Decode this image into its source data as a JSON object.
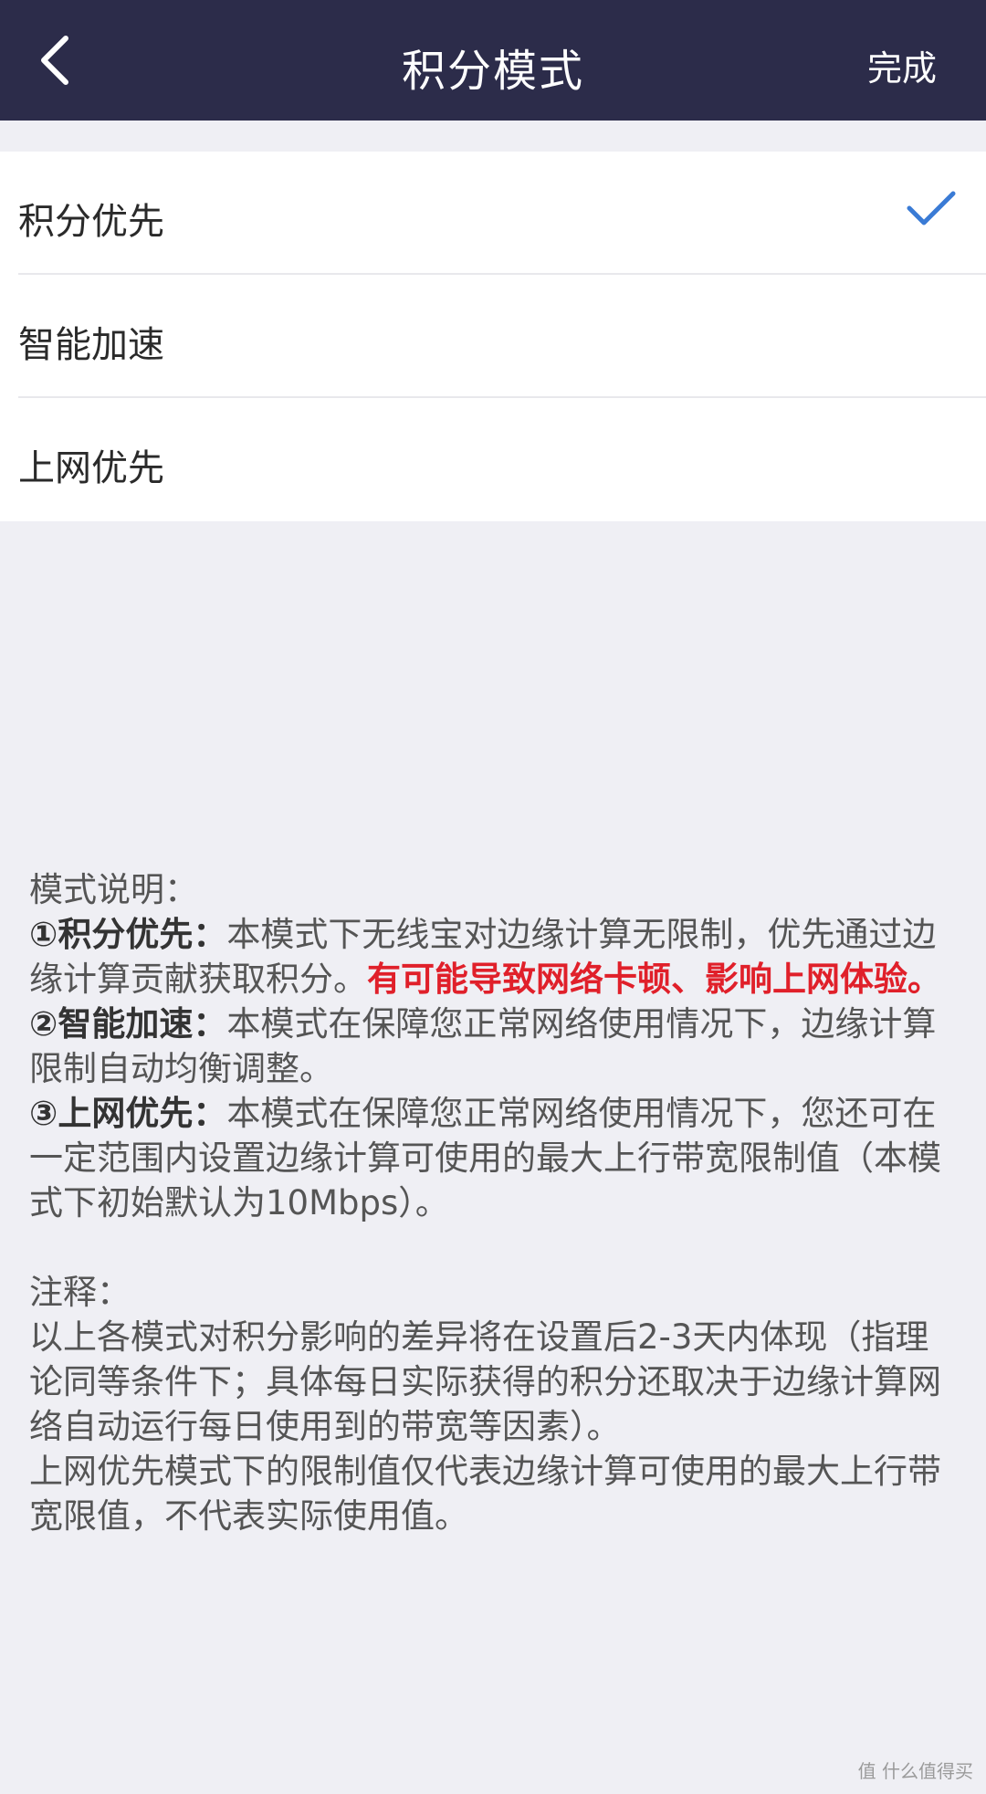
{
  "header": {
    "title": "积分模式",
    "done_label": "完成"
  },
  "options": [
    {
      "label": "积分优先",
      "selected": true
    },
    {
      "label": "智能加速",
      "selected": false
    },
    {
      "label": "上网优先",
      "selected": false
    }
  ],
  "description": {
    "heading": "模式说明：",
    "item1_title": "①积分优先：",
    "item1_text": "本模式下无线宝对边缘计算无限制，优先通过边缘计算贡献获取积分。",
    "item1_warning": "有可能导致网络卡顿、影响上网体验。",
    "item2_title": "②智能加速：",
    "item2_text": "本模式在保障您正常网络使用情况下，边缘计算限制自动均衡调整。",
    "item3_title": "③上网优先：",
    "item3_text": "本模式在保障您正常网络使用情况下，您还可在一定范围内设置边缘计算可使用的最大上行带宽限制值（本模式下初始默认为10Mbps）。",
    "note_heading": "注释：",
    "note_text1": "以上各模式对积分影响的差异将在设置后2-3天内体现（指理论同等条件下；具体每日实际获得的积分还取决于边缘计算网络自动运行每日使用到的带宽等因素）。",
    "note_text2": "上网优先模式下的限制值仅代表边缘计算可使用的最大上行带宽限值，不代表实际使用值。"
  },
  "watermark": "值 什么值得买",
  "colors": {
    "nav_bg": "#2c2c4a",
    "check": "#3a7bd5",
    "warning": "#e0202a"
  }
}
